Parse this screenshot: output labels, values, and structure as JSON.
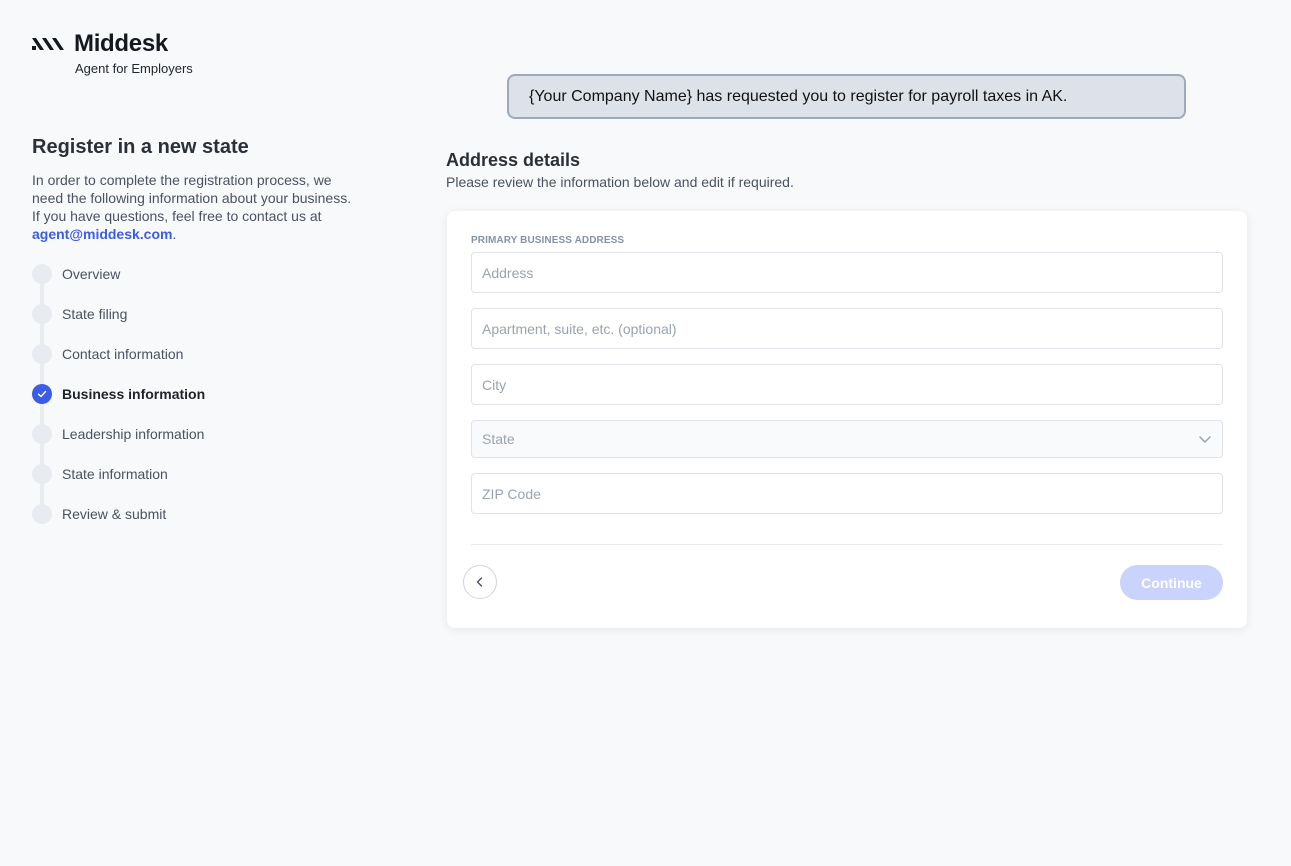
{
  "brand": {
    "name": "Middesk",
    "subtitle": "Agent for Employers",
    "logo_icon": "middesk-logo-icon"
  },
  "banner": {
    "text": "{Your Company Name} has requested you to register for payroll taxes in AK."
  },
  "sidebar": {
    "title": "Register in a new state",
    "intro_text": "In order to complete the registration process, we need the following information about your business. If you have questions, feel free to contact us at ",
    "email": "agent@middesk.com",
    "intro_end": ".",
    "steps": [
      {
        "label": "Overview",
        "status": "pending"
      },
      {
        "label": "State filing",
        "status": "pending"
      },
      {
        "label": "Contact information",
        "status": "pending"
      },
      {
        "label": "Business information",
        "status": "active"
      },
      {
        "label": "Leadership information",
        "status": "pending"
      },
      {
        "label": "State information",
        "status": "pending"
      },
      {
        "label": "Review & submit",
        "status": "pending"
      }
    ]
  },
  "main": {
    "title": "Address details",
    "subtitle": "Please review the information below and edit if required.",
    "section_label": "PRIMARY BUSINESS ADDRESS",
    "fields": {
      "address": {
        "value": "",
        "placeholder": "Address"
      },
      "apartment": {
        "value": "",
        "placeholder": "Apartment, suite, etc. (optional)"
      },
      "city": {
        "value": "",
        "placeholder": "City"
      },
      "state": {
        "value": "",
        "placeholder": "State"
      },
      "zip": {
        "value": "",
        "placeholder": "ZIP Code"
      }
    },
    "back_icon": "chevron-left-icon",
    "continue_label": "Continue"
  },
  "colors": {
    "accent": "#3b5ce4",
    "continue_disabled": "#c9d3fb",
    "banner_bg": "#dde2ea",
    "banner_border": "#9eaaba"
  }
}
